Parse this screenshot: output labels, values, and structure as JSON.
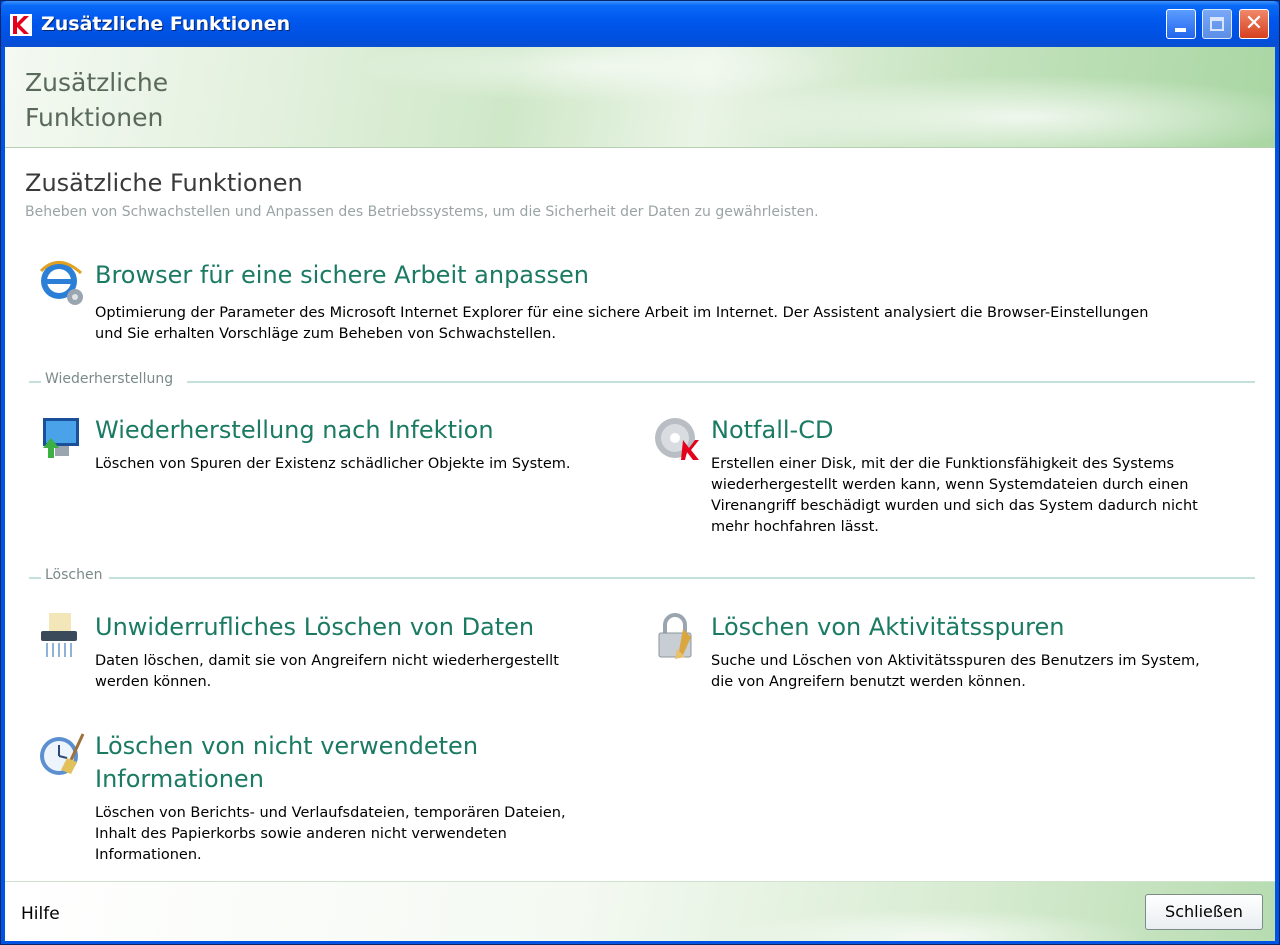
{
  "window": {
    "title": "Zusätzliche Funktionen"
  },
  "banner": {
    "title": "Zusätzliche\nFunktionen"
  },
  "page": {
    "title": "Zusätzliche Funktionen",
    "subtitle": "Beheben von Schwachstellen und Anpassen des Betriebssystems, um die Sicherheit der Daten zu gewährleisten."
  },
  "items": {
    "browser": {
      "title": "Browser für eine sichere Arbeit anpassen",
      "desc1": "Optimierung der Parameter des Microsoft Internet Explorer für eine sichere Arbeit im Internet. Der Assistent analysiert die Browser-Einstellungen",
      "desc2": "und Sie erhalten Vorschläge zum Beheben von Schwachstellen."
    },
    "restore": {
      "title": "Wiederherstellung nach Infektion",
      "desc1": "Löschen von Spuren der Existenz schädlicher Objekte im System."
    },
    "rescue_cd": {
      "title": "Notfall-CD",
      "desc1": "Erstellen einer Disk, mit der die Funktionsfähigkeit des Systems",
      "desc2": "wiederhergestellt werden kann, wenn Systemdateien durch einen",
      "desc3": "Virenangriff beschädigt wurden und sich das System dadurch nicht",
      "desc4": "mehr hochfahren lässt."
    },
    "shred": {
      "title": "Unwiderrufliches Löschen von Daten",
      "desc1": "Daten löschen, damit sie von Angreifern nicht wiederhergestellt",
      "desc2": "werden können."
    },
    "traces": {
      "title": "Löschen von Aktivitätsspuren",
      "desc1": "Suche und Löschen von Aktivitätsspuren des Benutzers im System,",
      "desc2": "die von Angreifern benutzt werden können."
    },
    "unused": {
      "title1": "Löschen von nicht verwendeten",
      "title2": "Informationen",
      "desc1": "Löschen von Berichts- und Verlaufsdateien, temporären Dateien,",
      "desc2": "Inhalt des Papierkorbs sowie anderen nicht verwendeten",
      "desc3": "Informationen."
    }
  },
  "sections": {
    "restore": "Wiederherstellung",
    "delete": "Löschen"
  },
  "footer": {
    "help": "Hilfe",
    "close": "Schließen"
  },
  "colors": {
    "heading": "#1a7a62",
    "titlebar": "#0058ee",
    "banner": "#cfe8c8"
  }
}
